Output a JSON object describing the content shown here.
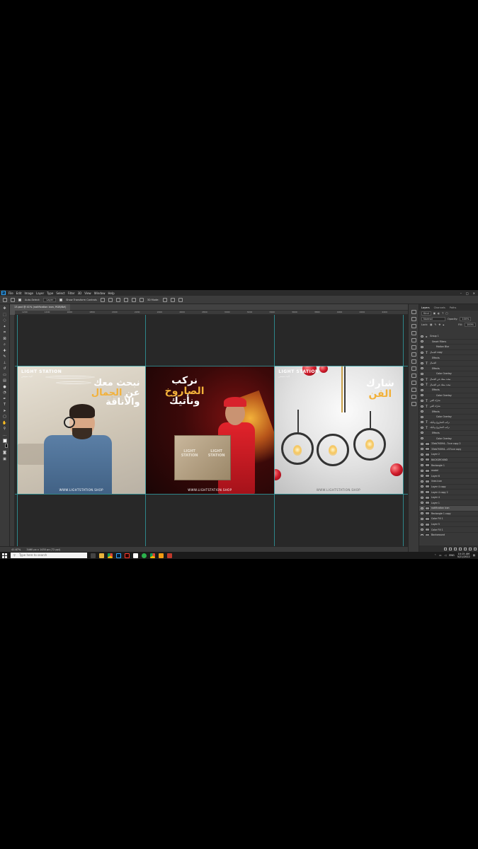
{
  "menubar": {
    "logo": "Ps",
    "items": [
      "File",
      "Edit",
      "Image",
      "Layer",
      "Type",
      "Select",
      "Filter",
      "3D",
      "View",
      "Window",
      "Help"
    ]
  },
  "options": {
    "auto_select_label": "Auto-Select:",
    "auto_select_target": "Layer",
    "show_transform_label": "Show Transform Controls",
    "mode_3d_label": "3D Mode:"
  },
  "document": {
    "tab_title": "13.psd @ 41% (notification icon, RGB/8#)",
    "zoom": "41.67%",
    "doc_info": "3460 px x 1430 px (72 ppi)"
  },
  "rulers": [
    "1200",
    "1400",
    "1600",
    "1800",
    "2000",
    "2200",
    "2400",
    "2600",
    "2800",
    "3000",
    "3200",
    "3400",
    "3600",
    "3800",
    "4000",
    "4200",
    "4400"
  ],
  "panels": {
    "panel1": {
      "brand": "LIGHT STATION",
      "brand_sub": "لايت ستيشن",
      "line1": "نبحث معك",
      "line2": "عن",
      "line3": "الجمال",
      "line4": "والأناقة",
      "website": "WWW.LIGHTSTATION.SHOP"
    },
    "panel2": {
      "line1": "نركب",
      "line2": "الصاروخ",
      "line3": "ونأتيك",
      "box_text": "LIGHT STATION",
      "website": "WWW.LIGHTSTATION.SHOP"
    },
    "panel3": {
      "brand": "LIGHT STATION",
      "brand_sub": "لايت ستيشن",
      "line1": "شارك",
      "line2": "الفن",
      "website": "WWW.LIGHTSTATION.SHOP"
    }
  },
  "layers_panel": {
    "tabs": [
      "Layers",
      "Channels",
      "Paths"
    ],
    "kind_label": "Kind",
    "blend_mode": "Normal",
    "opacity_label": "Opacity:",
    "opacity": "100%",
    "lock_label": "Lock:",
    "fill_label": "Fill:",
    "fill": "100%",
    "layers": [
      {
        "name": "Group 1",
        "type": "group",
        "indent": 0
      },
      {
        "name": "Smart Filters",
        "type": "fx",
        "indent": 1
      },
      {
        "name": "Motion Blur",
        "type": "fx",
        "indent": 2
      },
      {
        "name": "الجمال copy",
        "type": "text",
        "indent": 0
      },
      {
        "name": "Effects",
        "type": "fx",
        "indent": 1
      },
      {
        "name": "الجمال",
        "type": "text",
        "indent": 0
      },
      {
        "name": "Effects",
        "type": "fx",
        "indent": 1
      },
      {
        "name": "Color Overlay",
        "type": "fx",
        "indent": 2
      },
      {
        "name": "نبحث معك عن الجمال",
        "type": "text",
        "indent": 0
      },
      {
        "name": "نبحث معك عن الجمال",
        "type": "text",
        "indent": 0
      },
      {
        "name": "Effects",
        "type": "fx",
        "indent": 1
      },
      {
        "name": "Color Overlay",
        "type": "fx",
        "indent": 2
      },
      {
        "name": "شارك الفن",
        "type": "text",
        "indent": 0
      },
      {
        "name": "شارك الفن",
        "type": "text",
        "indent": 0
      },
      {
        "name": "Effects",
        "type": "fx",
        "indent": 1
      },
      {
        "name": "Color Overlay",
        "type": "fx",
        "indent": 2
      },
      {
        "name": "نركب الصاروخ ونأتيك",
        "type": "text",
        "indent": 0
      },
      {
        "name": "نركب الصاروخ ونأتيك",
        "type": "text",
        "indent": 0
      },
      {
        "name": "Effects",
        "type": "fx",
        "indent": 1
      },
      {
        "name": "Color Overlay",
        "type": "fx",
        "indent": 2
      },
      {
        "name": "33eb7f4594...7cce copy 2",
        "type": "image",
        "indent": 0
      },
      {
        "name": "33eb7f4594...c57cce copy",
        "type": "image",
        "indent": 0
      },
      {
        "name": "Layer 2",
        "type": "image",
        "indent": 0
      },
      {
        "name": "BACKGROUND",
        "type": "image",
        "indent": 0
      },
      {
        "name": "Rectangle 1",
        "type": "image",
        "indent": 0
      },
      {
        "name": "model",
        "type": "image",
        "indent": 0
      },
      {
        "name": "Layer 6",
        "type": "image",
        "indent": 0
      },
      {
        "name": "lines icon",
        "type": "image",
        "indent": 0
      },
      {
        "name": "Layer 4 copy",
        "type": "image",
        "indent": 0
      },
      {
        "name": "Layer 4 copy 2",
        "type": "image",
        "indent": 0
      },
      {
        "name": "Layer 4",
        "type": "image",
        "indent": 0
      },
      {
        "name": "Layer 1",
        "type": "image",
        "indent": 0
      },
      {
        "name": "notification icon",
        "type": "image",
        "indent": 0,
        "active": true
      },
      {
        "name": "Rectangle 1 copy",
        "type": "image",
        "indent": 0
      },
      {
        "name": "Color Fill 1",
        "type": "image",
        "indent": 0
      },
      {
        "name": "Layer 5",
        "type": "image",
        "indent": 0
      },
      {
        "name": "Color Fill 1",
        "type": "image",
        "indent": 0
      },
      {
        "name": "Background",
        "type": "image",
        "indent": 0
      }
    ]
  },
  "taskbar": {
    "search_placeholder": "Type here to search",
    "language": "ENG",
    "time": "10:15 AM",
    "date": "5/21/2022"
  },
  "colors": {
    "accent_gold": "#f2b13a",
    "guide_cyan": "#2f9da3",
    "ps_blue": "#31a8ff"
  }
}
